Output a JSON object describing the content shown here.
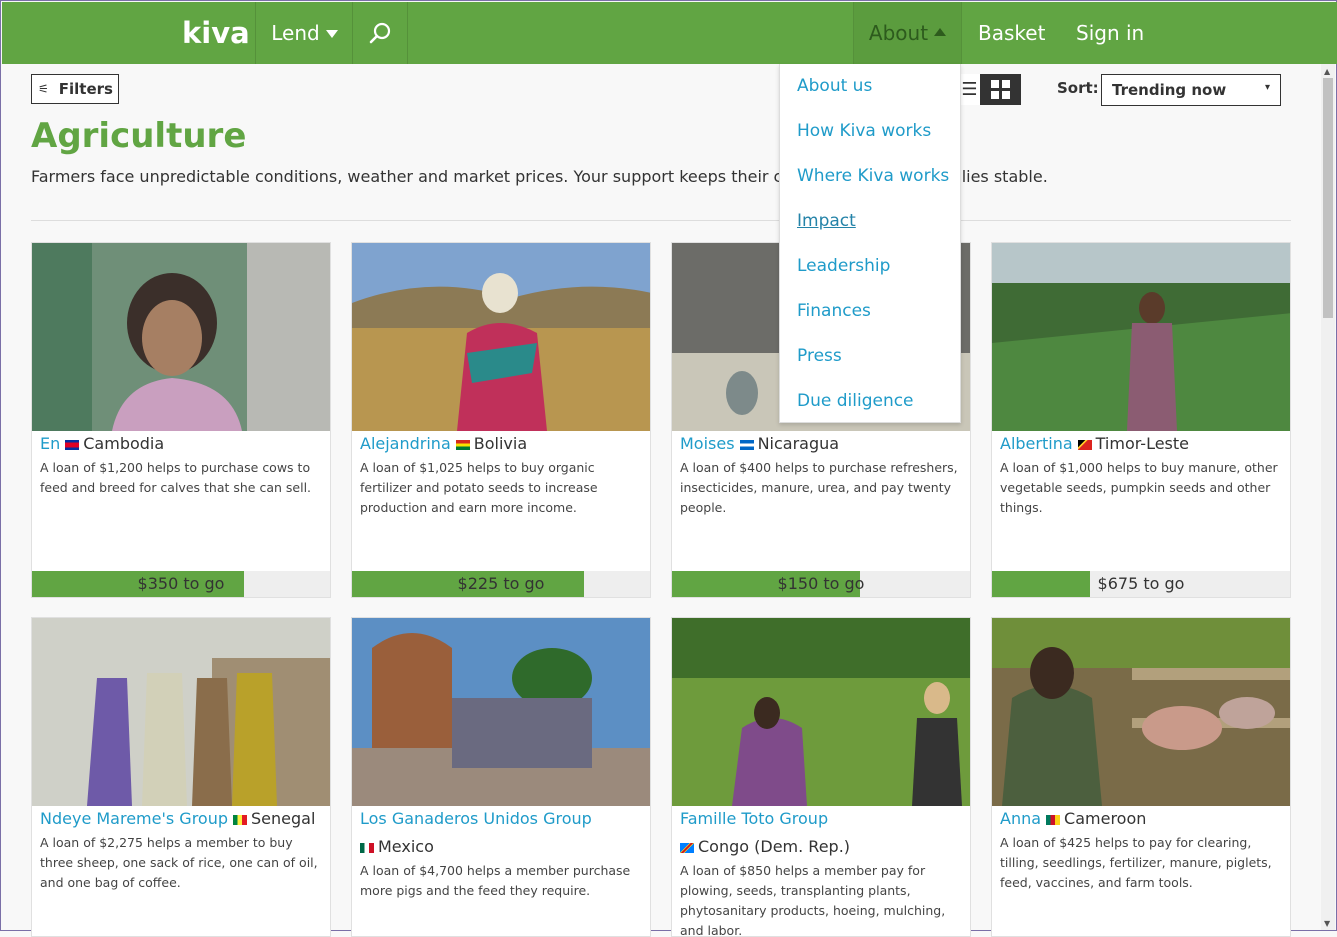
{
  "colors": {
    "brand_green": "#61a543",
    "link_blue": "#1f9bc9"
  },
  "nav": {
    "logo": "kiva",
    "lend": "Lend",
    "search_icon": "search-icon",
    "about": "About",
    "basket": "Basket",
    "signin": "Sign in"
  },
  "about_menu": {
    "items": [
      {
        "label": "About us"
      },
      {
        "label": "How Kiva works"
      },
      {
        "label": "Where Kiva works"
      },
      {
        "label": "Impact"
      },
      {
        "label": "Leadership"
      },
      {
        "label": "Finances"
      },
      {
        "label": "Press"
      },
      {
        "label": "Due diligence"
      }
    ]
  },
  "toolbar": {
    "filters": "Filters",
    "sort_label": "Sort:",
    "sort_value": "Trending now"
  },
  "page": {
    "title": "Agriculture",
    "description": "Farmers face unpredictable conditions, weather and market prices. Your support keeps their crops growing and families stable."
  },
  "loans": [
    {
      "name": "En",
      "country": "Cambodia",
      "description": "A loan of $1,200 helps to purchase cows to feed and breed for calves that she can sell.",
      "to_go": "$350 to go",
      "progress": 0.71
    },
    {
      "name": "Alejandrina",
      "country": "Bolivia",
      "description": "A loan of $1,025 helps to buy organic fertilizer and potato seeds to increase production and earn more income.",
      "to_go": "$225 to go",
      "progress": 0.78
    },
    {
      "name": "Moises",
      "country": "Nicaragua",
      "description": "A loan of $400 helps to purchase refreshers, insecticides, manure, urea, and pay twenty people.",
      "to_go": "$150 to go",
      "progress": 0.63
    },
    {
      "name": "Albertina",
      "country": "Timor-Leste",
      "description": "A loan of $1,000 helps to buy manure, other vegetable seeds, pumpkin seeds and other things.",
      "to_go": "$675 to go",
      "progress": 0.33
    },
    {
      "name": "Ndeye Mareme's Group",
      "country": "Senegal",
      "description": "A loan of $2,275 helps a member to buy three sheep, one sack of rice, one can of oil, and one bag of coffee."
    },
    {
      "name": "Los Ganaderos Unidos Group",
      "country": "Mexico",
      "description": "A loan of $4,700 helps a member purchase more pigs and the feed they require."
    },
    {
      "name": "Famille Toto Group",
      "country": "Congo (Dem. Rep.)",
      "description": "A loan of $850 helps a member pay for plowing, seeds, transplanting plants, phytosanitary products, hoeing, mulching, and labor."
    },
    {
      "name": "Anna",
      "country": "Cameroon",
      "description": "A loan of $425 helps to pay for clearing, tilling, seedlings, fertilizer, manure, piglets, feed, vaccines, and farm tools."
    }
  ]
}
